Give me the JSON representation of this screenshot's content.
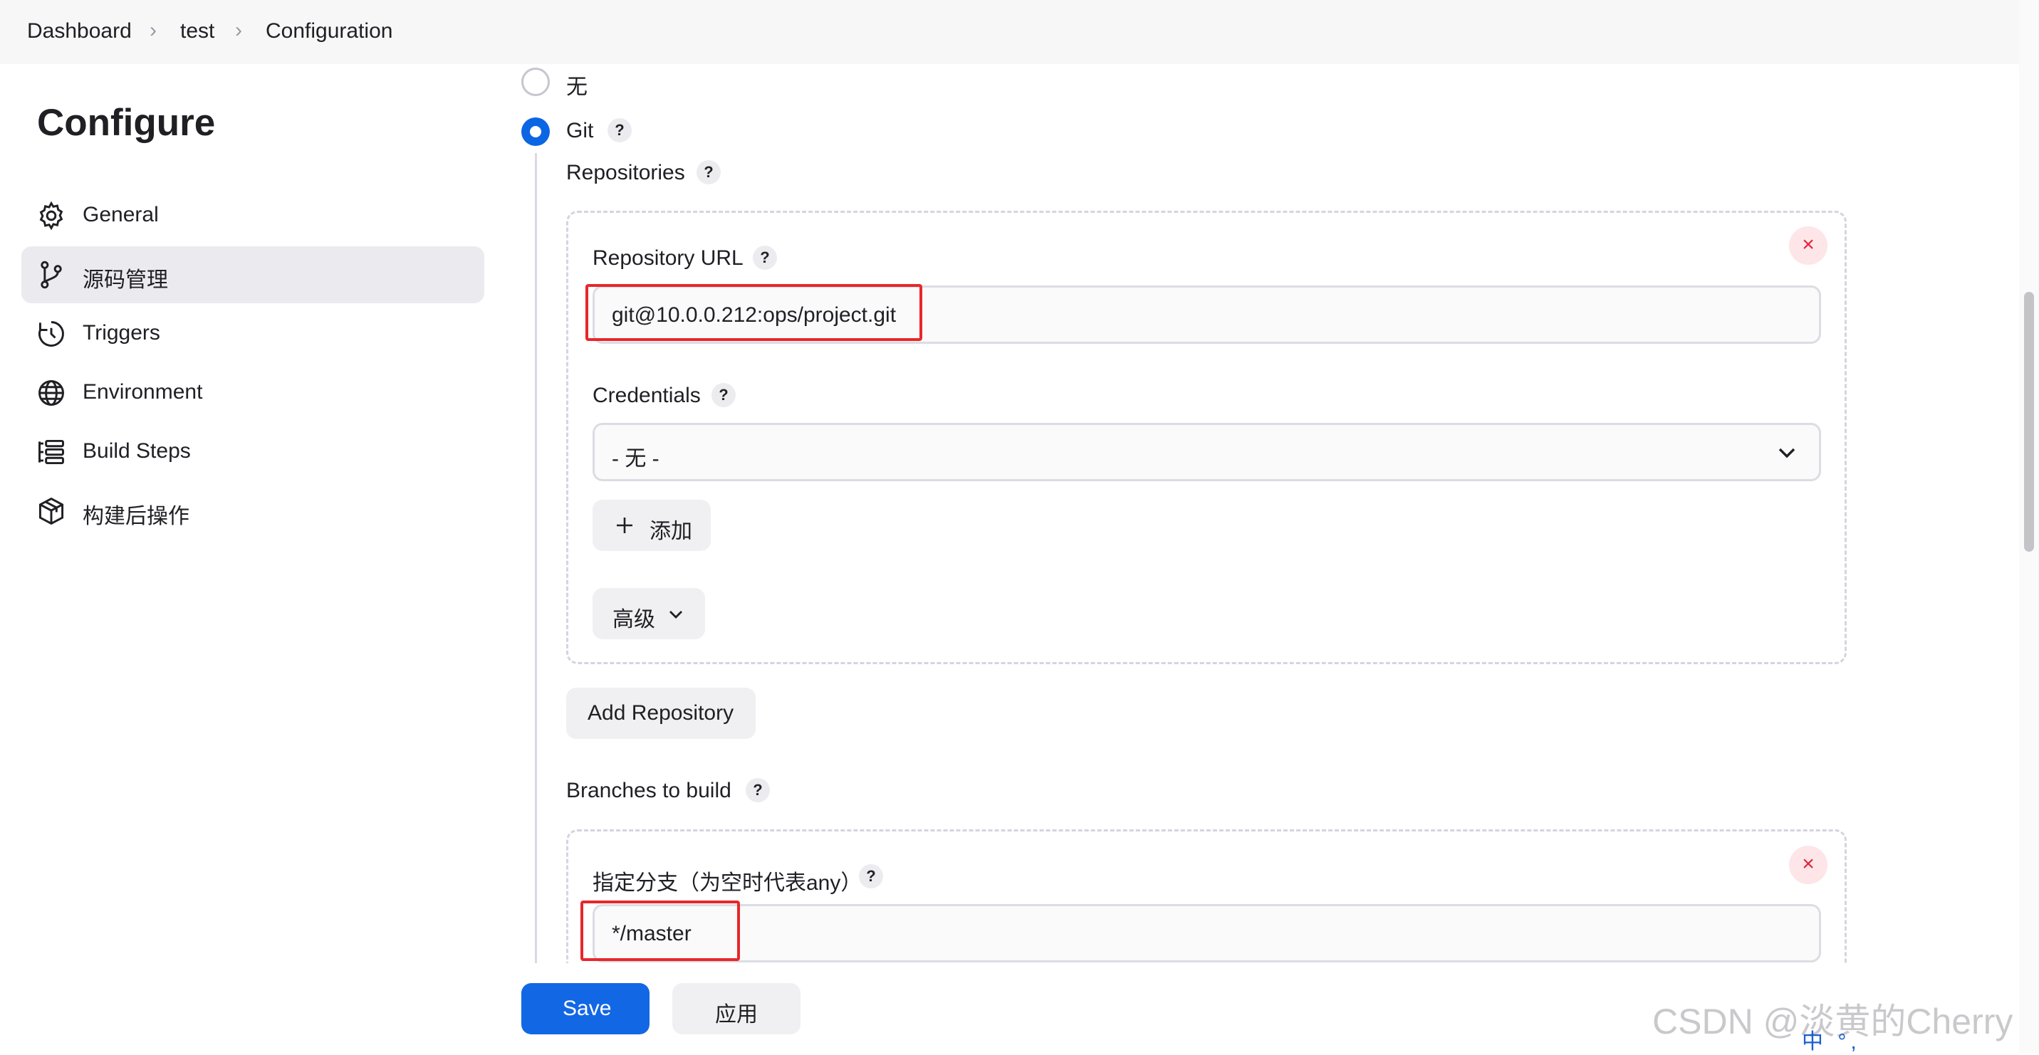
{
  "breadcrumb": {
    "items": [
      "Dashboard",
      "test",
      "Configuration"
    ]
  },
  "sidebar": {
    "title": "Configure",
    "items": [
      {
        "label": "General",
        "icon": "gear-icon"
      },
      {
        "label": "源码管理",
        "icon": "branch-icon",
        "active": true
      },
      {
        "label": "Triggers",
        "icon": "clock-icon"
      },
      {
        "label": "Environment",
        "icon": "globe-icon"
      },
      {
        "label": "Build Steps",
        "icon": "list-icon"
      },
      {
        "label": "构建后操作",
        "icon": "package-icon"
      }
    ]
  },
  "scm": {
    "options": [
      {
        "label": "无",
        "selected": false
      },
      {
        "label": "Git",
        "selected": true
      }
    ],
    "help": "?",
    "repositories": {
      "label": "Repositories",
      "url_label": "Repository URL",
      "url_value": "git@10.0.0.212:ops/project.git",
      "credentials_label": "Credentials",
      "credentials_value": "- 无 -",
      "add_label": "添加",
      "advanced_label": "高级",
      "delete_symbol": "×",
      "add_repository_label": "Add Repository"
    },
    "branches": {
      "label": "Branches to build",
      "branch_label": "指定分支（为空时代表any）",
      "branch_value": "*/master"
    }
  },
  "actions": {
    "save_label": "Save",
    "apply_label": "应用"
  },
  "watermark": "CSDN @淡黄的Cherry",
  "taskbar_glyphs": "中 °, ",
  "colors": {
    "primary": "#1267e5",
    "danger": "#e0243b",
    "highlight": "#e8272a"
  }
}
